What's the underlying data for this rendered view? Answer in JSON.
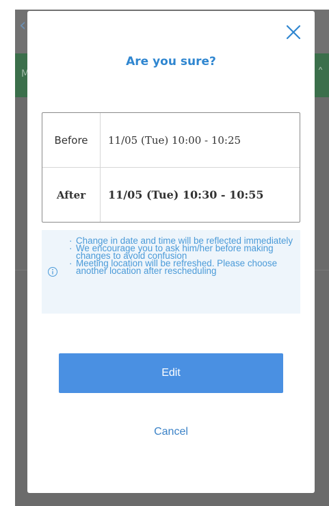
{
  "background": {
    "back_icon": "chevron-left-icon",
    "green_bar_letter": "M",
    "green_bar_icon": "chevron-up-icon"
  },
  "modal": {
    "close_icon": "close-icon",
    "title": "Are you sure?",
    "comparison": {
      "before_label": "Before",
      "before_value": "11/05 (Tue) 10:00 - 10:25",
      "after_label": "After",
      "after_value": "11/05 (Tue) 10:30 - 10:55"
    },
    "notice": {
      "icon": "info-icon",
      "items": [
        "Change in date and time will be reflected immediately",
        "We encourage you to ask him/her before making changes to avoid confusion",
        "Meeting location will be refreshed. Please choose another location after rescheduling"
      ]
    },
    "edit_label": "Edit",
    "cancel_label": "Cancel"
  },
  "colors": {
    "accent": "#4a90e2",
    "title": "#2f86d0",
    "notice_bg": "#eef5fb",
    "notice_text": "#4a9ad8"
  }
}
